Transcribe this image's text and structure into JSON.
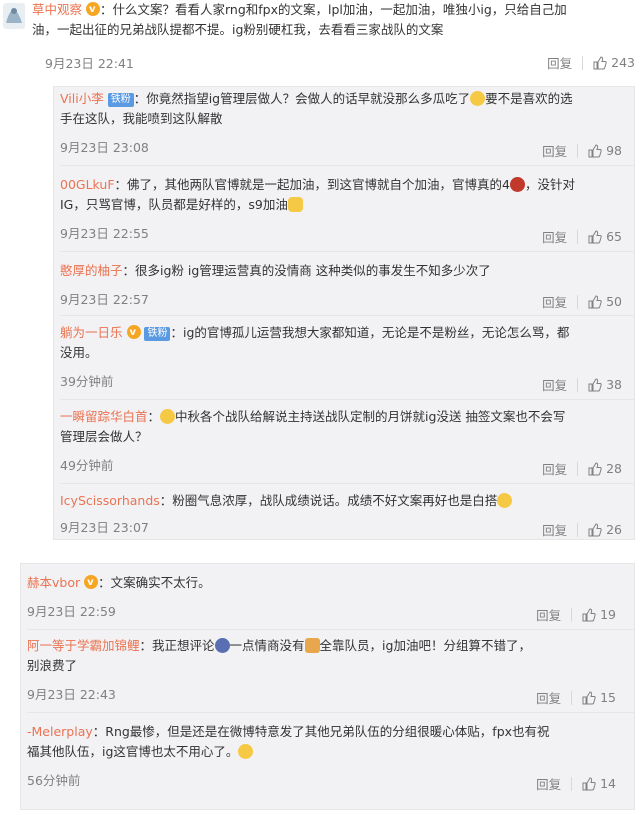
{
  "main": {
    "user": "草中观察",
    "text_line1": "：什么文案？看看人家rng和fpx的文案，lpl加油，一起加油，唯独小ig，只给自己加",
    "text_line2": "油，一起出征的兄弟战队提都不提。ig粉别硬杠我，去看看三家战队的文案",
    "date": "9月23日 22:41",
    "reply_label": "回复",
    "likes": "243"
  },
  "replies": [
    {
      "user": "Vili小李",
      "tag": "铁粉",
      "text_line1": "：你竟然指望ig管理层做人？会做人的话早就没那么多瓜吃了",
      "text_line1b": "要不是喜欢的选",
      "text_line2": "手在这队，我能喷到这队解散",
      "date": "9月23日 23:08",
      "reply_label": "回复",
      "likes": "98"
    },
    {
      "user": "00GLkuF",
      "text_line1": "：佛了，其他两队官博就是一起加油，到这官博就自个加油，官博真的4",
      "text_line1b": "，没针对",
      "text_line2": "IG，只骂官博，队员都是好样的，s9加油",
      "date": "9月23日 22:55",
      "reply_label": "回复",
      "likes": "65"
    },
    {
      "user": "憨厚的柚子",
      "text_line1": "：很多ig粉 ig管理运营真的没情商 这种类似的事发生不知多少次了",
      "date": "9月23日 22:57",
      "reply_label": "回复",
      "likes": "50"
    },
    {
      "user": "躺为一日乐",
      "tag": "铁粉",
      "text_line1": "：ig的官博孤儿运营我想大家都知道，无论是不是粉丝，无论怎么骂，都",
      "text_line2": "没用。",
      "date": "39分钟前",
      "reply_label": "回复",
      "likes": "38"
    },
    {
      "user": "一瞬留踪华白首",
      "text_line1": "中秋各个战队给解说主持送战队定制的月饼就ig没送 抽签文案也不会写",
      "text_line2": "管理层会做人？",
      "date": "49分钟前",
      "reply_label": "回复",
      "likes": "28"
    },
    {
      "user": "IcyScissorhands",
      "text_line1": "：粉圈气息浓厚，战队成绩说话。成绩不好文案再好也是白搭",
      "date": "9月23日 23:07",
      "reply_label": "回复",
      "likes": "26"
    }
  ],
  "replies2": [
    {
      "user": "赫本vbor",
      "text_line1": "：文案确实不太行。",
      "date": "9月23日 22:59",
      "reply_label": "回复",
      "likes": "19"
    },
    {
      "user": "阿一等于学霸加锦鲤",
      "text_line1": "：我正想评论",
      "text_line1b": "一点情商没有",
      "text_line1c": "全靠队员，ig加油吧！分组算不错了，",
      "text_line2": "别浪费了",
      "date": "9月23日 22:43",
      "reply_label": "回复",
      "likes": "15"
    },
    {
      "user": "-Melerplay",
      "text_line1": "：Rng最惨，但是还是在微博特意发了其他兄弟队伍的分组很暖心体贴，fpx也有祝",
      "text_line2": "福其他队伍，ig这官博也太不用心了。",
      "date": "56分钟前",
      "reply_label": "回复",
      "likes": "14"
    }
  ],
  "colors": {
    "username": "#eb7350",
    "meta": "#808080",
    "box_bg": "#f2f2f5"
  },
  "icons": {
    "like": "thumbs-up-icon",
    "vip": "vip-badge-icon"
  }
}
